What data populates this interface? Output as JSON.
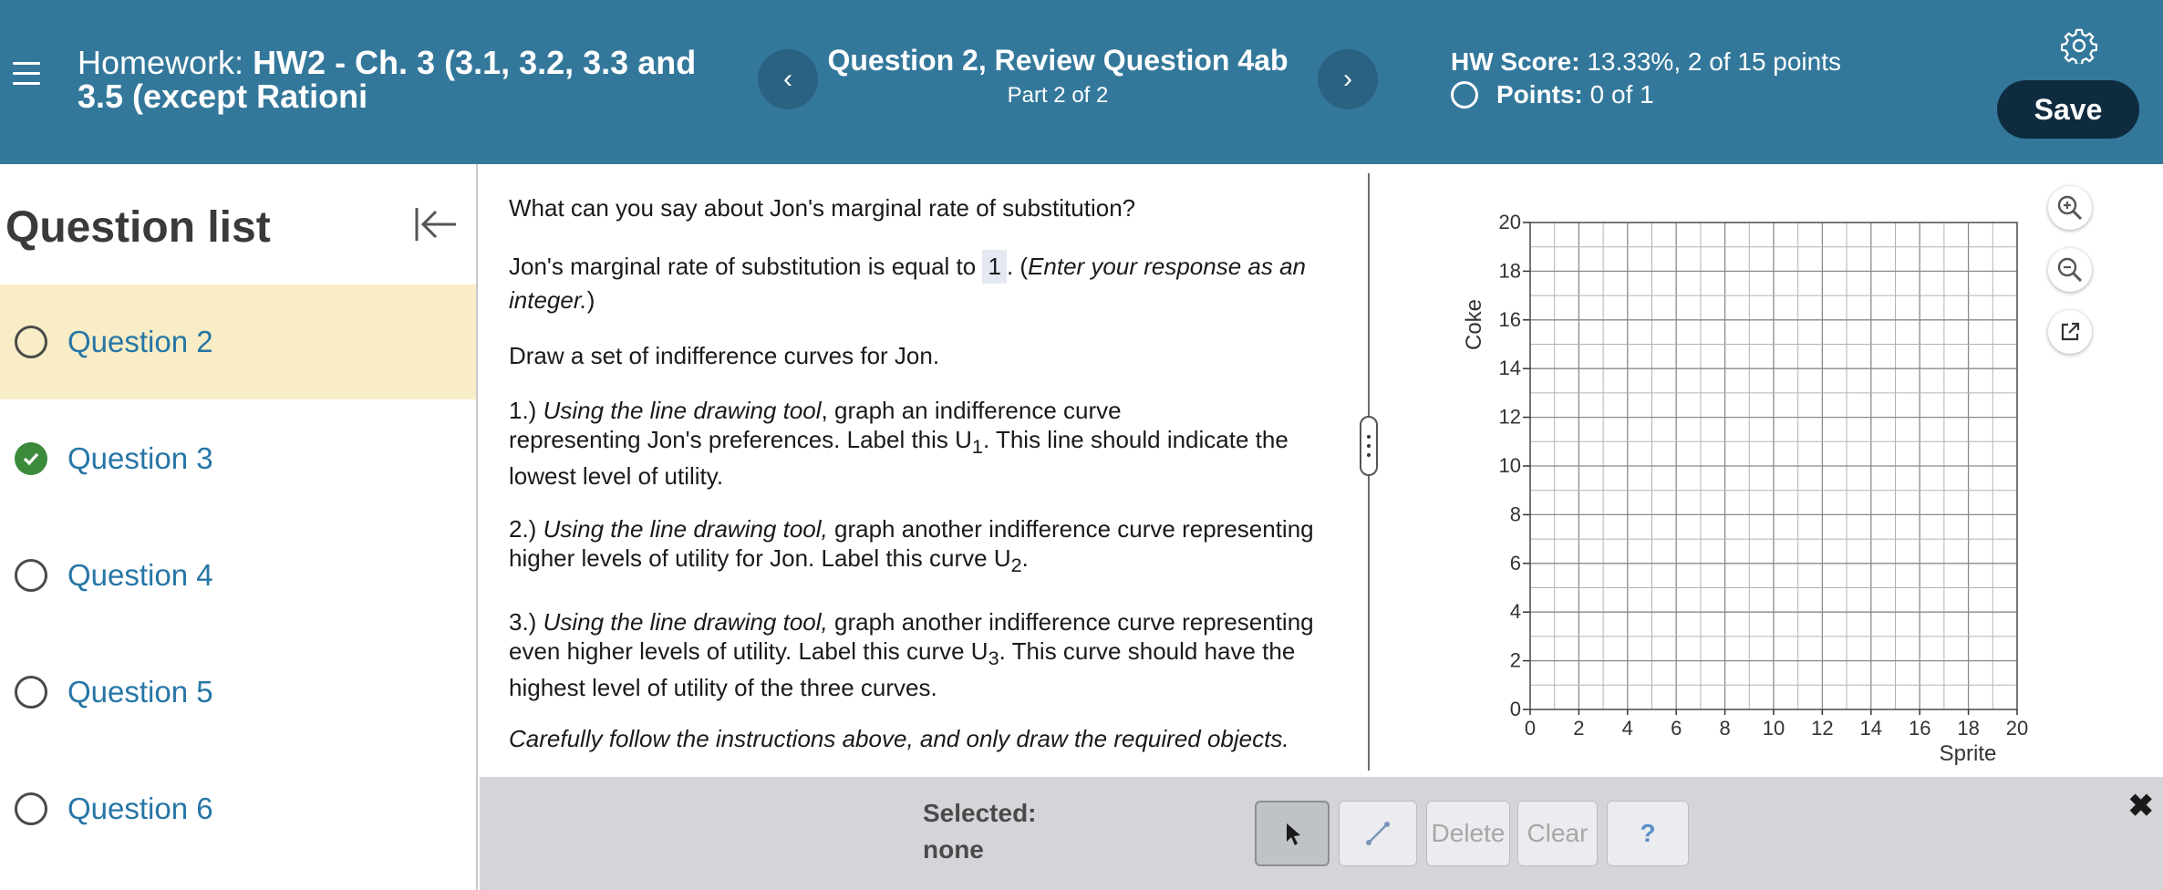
{
  "header": {
    "homework_label": "Homework:",
    "homework_name": "HW2 - Ch. 3 (3.1, 3.2, 3.3 and 3.5 (except Rationi",
    "question_title": "Question 2, Review Question 4ab",
    "question_part": "Part 2 of 2",
    "score_label": "HW Score:",
    "score_value": "13.33%, 2 of 15 points",
    "points_label": "Points:",
    "points_value": "0 of 1",
    "save_label": "Save",
    "prev_icon": "‹",
    "next_icon": "›"
  },
  "sidebar": {
    "title": "Question list",
    "items": [
      {
        "label": "Question 2",
        "status": "unanswered",
        "active": true
      },
      {
        "label": "Question 3",
        "status": "correct",
        "active": false
      },
      {
        "label": "Question 4",
        "status": "unanswered",
        "active": false
      },
      {
        "label": "Question 5",
        "status": "unanswered",
        "active": false
      },
      {
        "label": "Question 6",
        "status": "unanswered",
        "active": false
      }
    ]
  },
  "question": {
    "prompt": "What can you say about Jon's marginal rate of substitution?",
    "mrs_prefix": "Jon's marginal rate of substitution is equal to",
    "mrs_answer": "1",
    "mrs_suffix_plain": ". (",
    "mrs_suffix_italic": "Enter your response as an integer.",
    "mrs_suffix_end": ")",
    "draw_intro": "Draw a set of indifference curves for Jon.",
    "step1_num": "1.)",
    "step1_italic": "Using the line drawing tool",
    "step1_text_a": ", graph an indifference curve",
    "step1_text_b": "representing Jon's preferences. Label this U",
    "step1_sub": "1",
    "step1_text_c": ". This line should indicate the",
    "step1_text_d": "lowest level of utility.",
    "step2_num": "2.)",
    "step2_italic": "Using the line drawing tool,",
    "step2_text_a": " graph another indifference curve representing",
    "step2_text_b": "higher levels of utility for Jon. Label this curve U",
    "step2_sub": "2",
    "step2_end": ".",
    "step3_num": "3.)",
    "step3_italic": "Using the line drawing tool,",
    "step3_text_a": " graph another indifference curve representing",
    "step3_text_b": "even higher levels of utility. Label this curve U",
    "step3_sub": "3",
    "step3_text_c": ". This curve should have the",
    "step3_text_d": "highest level of utility of the three curves.",
    "note": "Carefully follow the instructions above, and only draw the required objects."
  },
  "graph": {
    "xlabel": "Sprite",
    "ylabel": "Coke",
    "x_ticks": [
      "0",
      "2",
      "4",
      "6",
      "8",
      "10",
      "12",
      "14",
      "16",
      "18",
      "20"
    ],
    "y_ticks": [
      "0",
      "2",
      "4",
      "6",
      "8",
      "10",
      "12",
      "14",
      "16",
      "18",
      "20"
    ],
    "x_range": [
      0,
      20
    ],
    "y_range": [
      0,
      20
    ],
    "minor_step": 1,
    "grid": true
  },
  "toolbar": {
    "selected_label": "Selected:",
    "selected_value": "none",
    "delete_label": "Delete",
    "clear_label": "Clear",
    "help_label": "?"
  },
  "colors": {
    "header_bg": "#33789b",
    "save_bg": "#0f2b40",
    "link": "#2776a6",
    "active_item": "#f8edc6",
    "correct": "#3a8a3a",
    "help": "#5b8fc7"
  }
}
